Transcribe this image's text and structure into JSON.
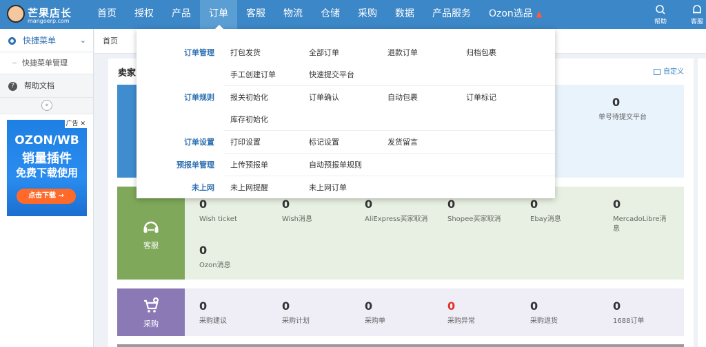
{
  "brand": {
    "name": "芒果店长",
    "url": "mangoerp.com"
  },
  "nav": [
    "首页",
    "授权",
    "产品",
    "订单",
    "客服",
    "物流",
    "仓储",
    "采购",
    "数据",
    "产品服务",
    "Ozon选品"
  ],
  "top_right": {
    "help": "帮助",
    "service": "客服"
  },
  "sidebar": {
    "quick_menu": "快捷菜单",
    "quick_manage": "快捷菜单管理",
    "help_docs": "帮助文档"
  },
  "ad": {
    "tag": "广告",
    "line1": "OZON/WB",
    "line2": "销量插件",
    "line3": "免费下载使用",
    "button": "点击下载 →"
  },
  "breadcrumb": "首页",
  "panel": {
    "title": "卖家",
    "customize": "自定义"
  },
  "dropdown": [
    {
      "category": "订单管理",
      "links": [
        "打包发货",
        "全部订单",
        "退款订单",
        "归档包裹",
        "手工创建订单",
        "快速提交平台"
      ]
    },
    {
      "category": "订单规则",
      "links": [
        "报关初始化",
        "订单确认",
        "自动包裹",
        "订单标记",
        "库存初始化"
      ]
    },
    {
      "category": "订单设置",
      "links": [
        "打印设置",
        "标记设置",
        "发货留言"
      ]
    },
    {
      "category": "预报单管理",
      "links": [
        "上传预报单",
        "自动预报单规则"
      ]
    },
    {
      "category": "未上网",
      "links": [
        "未上网提醒",
        "未上网订单"
      ]
    }
  ],
  "order_section": {
    "partial_label": "单号",
    "pending_value": "0",
    "pending_label": "待提交平台"
  },
  "service_section": {
    "label": "客服",
    "metrics": [
      {
        "value": "0",
        "label": "Wish ticket"
      },
      {
        "value": "0",
        "label": "Wish消息"
      },
      {
        "value": "0",
        "label": "AliExpress买家取消"
      },
      {
        "value": "0",
        "label": "Shopee买家取消"
      },
      {
        "value": "0",
        "label": "Ebay消息"
      },
      {
        "value": "0",
        "label": "MercadoLibre消息"
      },
      {
        "value": "0",
        "label": "Ozon消息"
      }
    ]
  },
  "purchase_section": {
    "label": "采购",
    "metrics": [
      {
        "value": "0",
        "label": "采购建议"
      },
      {
        "value": "0",
        "label": "采购计划"
      },
      {
        "value": "0",
        "label": "采购单"
      },
      {
        "value": "0",
        "label": "采购异常"
      },
      {
        "value": "0",
        "label": "采购退货"
      },
      {
        "value": "0",
        "label": "1688订单"
      }
    ]
  },
  "colors": {
    "topbar": "#3c87c7",
    "order_card": "#3f8ccf",
    "service_card": "#7fa85a",
    "purchase_card": "#8b79b6",
    "alert_red": "#e0342a"
  }
}
